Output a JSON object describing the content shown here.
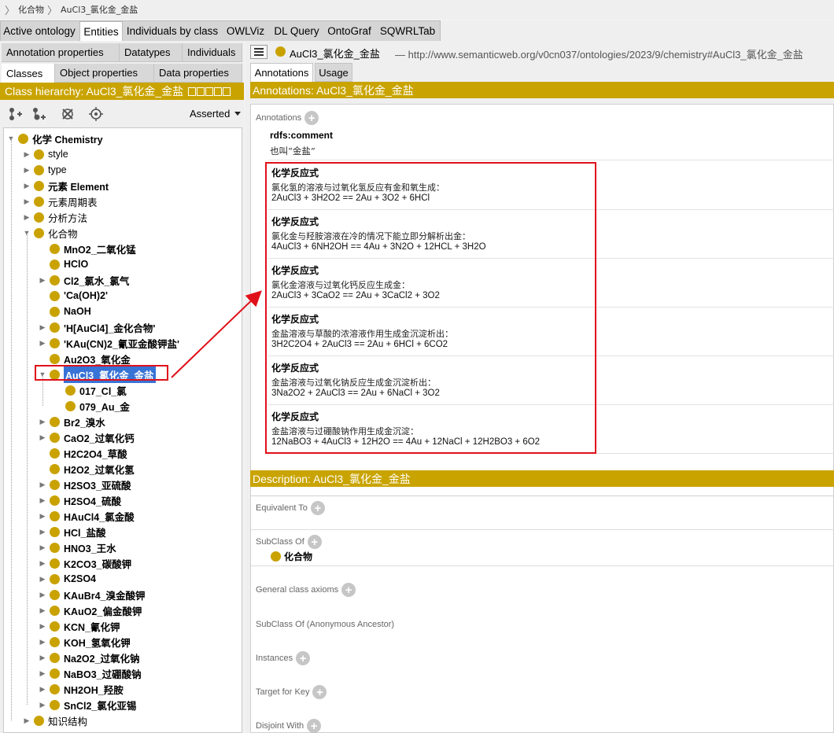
{
  "breadcrumb": {
    "items": [
      "化合物",
      "AuCl3_氯化金_金盐"
    ]
  },
  "top_tabs": [
    "Active ontology",
    "Entities",
    "Individuals by class",
    "OWLViz",
    "DL Query",
    "OntoGraf",
    "SQWRLTab"
  ],
  "active_top_tab": "Entities",
  "left": {
    "subtabs_row1": [
      "Annotation properties",
      "Datatypes",
      "Individuals"
    ],
    "subtabs_row2": [
      "Classes",
      "Object properties",
      "Data properties"
    ],
    "header": "Class hierarchy: AuCl3_氯化金_金盐",
    "toolbar_icons": [
      "add-subclass-icon",
      "add-sibling-icon",
      "delete-class-icon",
      "target-icon"
    ],
    "dropdown": "Asserted",
    "tree": [
      {
        "label": "化学 Chemistry",
        "depth": 0,
        "bold": true,
        "state": "expanded"
      },
      {
        "label": "style",
        "depth": 1,
        "state": "collapsed"
      },
      {
        "label": "type",
        "depth": 1,
        "state": "collapsed"
      },
      {
        "label": "元素 Element",
        "depth": 1,
        "bold": true,
        "state": "collapsed"
      },
      {
        "label": "元素周期表",
        "depth": 1,
        "state": "collapsed"
      },
      {
        "label": "分析方法",
        "depth": 1,
        "state": "collapsed"
      },
      {
        "label": "化合物",
        "depth": 1,
        "state": "expanded"
      },
      {
        "label": "MnO2_二氧化锰",
        "depth": 2,
        "bold": true,
        "state": "leaf"
      },
      {
        "label": "HClO",
        "depth": 2,
        "bold": true,
        "state": "leaf"
      },
      {
        "label": "Cl2_氯水_氯气",
        "depth": 2,
        "bold": true,
        "state": "collapsed"
      },
      {
        "label": "'Ca(OH)2'",
        "depth": 2,
        "bold": true,
        "state": "leaf"
      },
      {
        "label": "NaOH",
        "depth": 2,
        "bold": true,
        "state": "leaf"
      },
      {
        "label": "'H[AuCl4]_金化合物'",
        "depth": 2,
        "bold": true,
        "state": "collapsed"
      },
      {
        "label": "'KAu(CN)2_氰亚金酸钾盐'",
        "depth": 2,
        "bold": true,
        "state": "collapsed"
      },
      {
        "label": "Au2O3_氧化金",
        "depth": 2,
        "bold": true,
        "state": "leaf"
      },
      {
        "label": "AuCl3_氯化金_金盐",
        "depth": 2,
        "bold": true,
        "state": "expanded",
        "selected": true
      },
      {
        "label": "017_Cl_氯",
        "depth": 3,
        "bold": true,
        "state": "leaf"
      },
      {
        "label": "079_Au_金",
        "depth": 3,
        "bold": true,
        "state": "leaf"
      },
      {
        "label": "Br2_溴水",
        "depth": 2,
        "bold": true,
        "state": "collapsed"
      },
      {
        "label": "CaO2_过氧化钙",
        "depth": 2,
        "bold": true,
        "state": "collapsed"
      },
      {
        "label": "H2C2O4_草酸",
        "depth": 2,
        "bold": true,
        "state": "leaf"
      },
      {
        "label": "H2O2_过氧化氢",
        "depth": 2,
        "bold": true,
        "state": "leaf"
      },
      {
        "label": "H2SO3_亚硫酸",
        "depth": 2,
        "bold": true,
        "state": "collapsed"
      },
      {
        "label": "H2SO4_硫酸",
        "depth": 2,
        "bold": true,
        "state": "collapsed"
      },
      {
        "label": "HAuCl4_氯金酸",
        "depth": 2,
        "bold": true,
        "state": "collapsed"
      },
      {
        "label": "HCl_盐酸",
        "depth": 2,
        "bold": true,
        "state": "collapsed"
      },
      {
        "label": "HNO3_王水",
        "depth": 2,
        "bold": true,
        "state": "collapsed"
      },
      {
        "label": "K2CO3_碳酸钾",
        "depth": 2,
        "bold": true,
        "state": "collapsed"
      },
      {
        "label": "K2SO4",
        "depth": 2,
        "bold": true,
        "state": "collapsed"
      },
      {
        "label": "KAuBr4_溴金酸钾",
        "depth": 2,
        "bold": true,
        "state": "collapsed"
      },
      {
        "label": "KAuO2_偏金酸钾",
        "depth": 2,
        "bold": true,
        "state": "collapsed"
      },
      {
        "label": "KCN_氰化钾",
        "depth": 2,
        "bold": true,
        "state": "collapsed"
      },
      {
        "label": "KOH_氢氧化钾",
        "depth": 2,
        "bold": true,
        "state": "collapsed"
      },
      {
        "label": "Na2O2_过氧化钠",
        "depth": 2,
        "bold": true,
        "state": "collapsed"
      },
      {
        "label": "NaBO3_过硼酸钠",
        "depth": 2,
        "bold": true,
        "state": "collapsed"
      },
      {
        "label": "NH2OH_羟胺",
        "depth": 2,
        "bold": true,
        "state": "collapsed"
      },
      {
        "label": "SnCl2_氯化亚锡",
        "depth": 2,
        "bold": true,
        "state": "collapsed"
      },
      {
        "label": "知识结构",
        "depth": 1,
        "state": "collapsed"
      }
    ]
  },
  "right": {
    "entity_name": "AuCl3_氯化金_金盐",
    "entity_iri": "— http://www.semanticweb.org/v0cn037/ontologies/2023/9/chemistry#AuCl3_氯化金_金盐",
    "tabs": [
      "Annotations",
      "Usage"
    ],
    "annotations_header": "Annotations: AuCl3_氯化金_金盐",
    "annotations_label": "Annotations",
    "comment_property": "rdfs:comment",
    "comment_value": "也叫“金盐”",
    "reactions": [
      {
        "property": "化学反应式",
        "text": "氯化氢的溶液与过氧化氢反应有金和氧生成：",
        "equation": "2AuCl3 + 3H2O2 == 2Au + 3O2 + 6HCl"
      },
      {
        "property": "化学反应式",
        "text": "氯化金与羟胺溶液在冷的情况下能立即分解析出金：",
        "equation": "4AuCl3 + 6NH2OH == 4Au + 3N2O + 12HCL + 3H2O"
      },
      {
        "property": "化学反应式",
        "text": "氯化金溶液与过氧化钙反应生成金：",
        "equation": "2AuCl3 + 3CaO2 == 2Au + 3CaCl2 + 3O2"
      },
      {
        "property": "化学反应式",
        "text": "金盐溶液与草酸的浓溶液作用生成金沉淀析出：",
        "equation": "3H2C2O4 + 2AuCl3 == 2Au + 6HCl + 6CO2"
      },
      {
        "property": "化学反应式",
        "text": "金盐溶液与过氧化钠反应生成金沉淀析出：",
        "equation": "3Na2O2 + 2AuCl3 == 2Au + 6NaCl + 3O2"
      },
      {
        "property": "化学反应式",
        "text": "金盐溶液与过硼酸钠作用生成金沉淀：",
        "equation": "12NaBO3 + 4AuCl3 + 12H2O == 4Au + 12NaCl + 12H2BO3 + 6O2"
      }
    ],
    "description_header": "Description: AuCl3_氯化金_金盐",
    "description_sections": [
      "Equivalent To",
      "SubClass Of",
      "General class axioms",
      "SubClass Of (Anonymous Ancestor)",
      "Instances",
      "Target for Key",
      "Disjoint With"
    ],
    "subclass_of_value": "化合物"
  }
}
